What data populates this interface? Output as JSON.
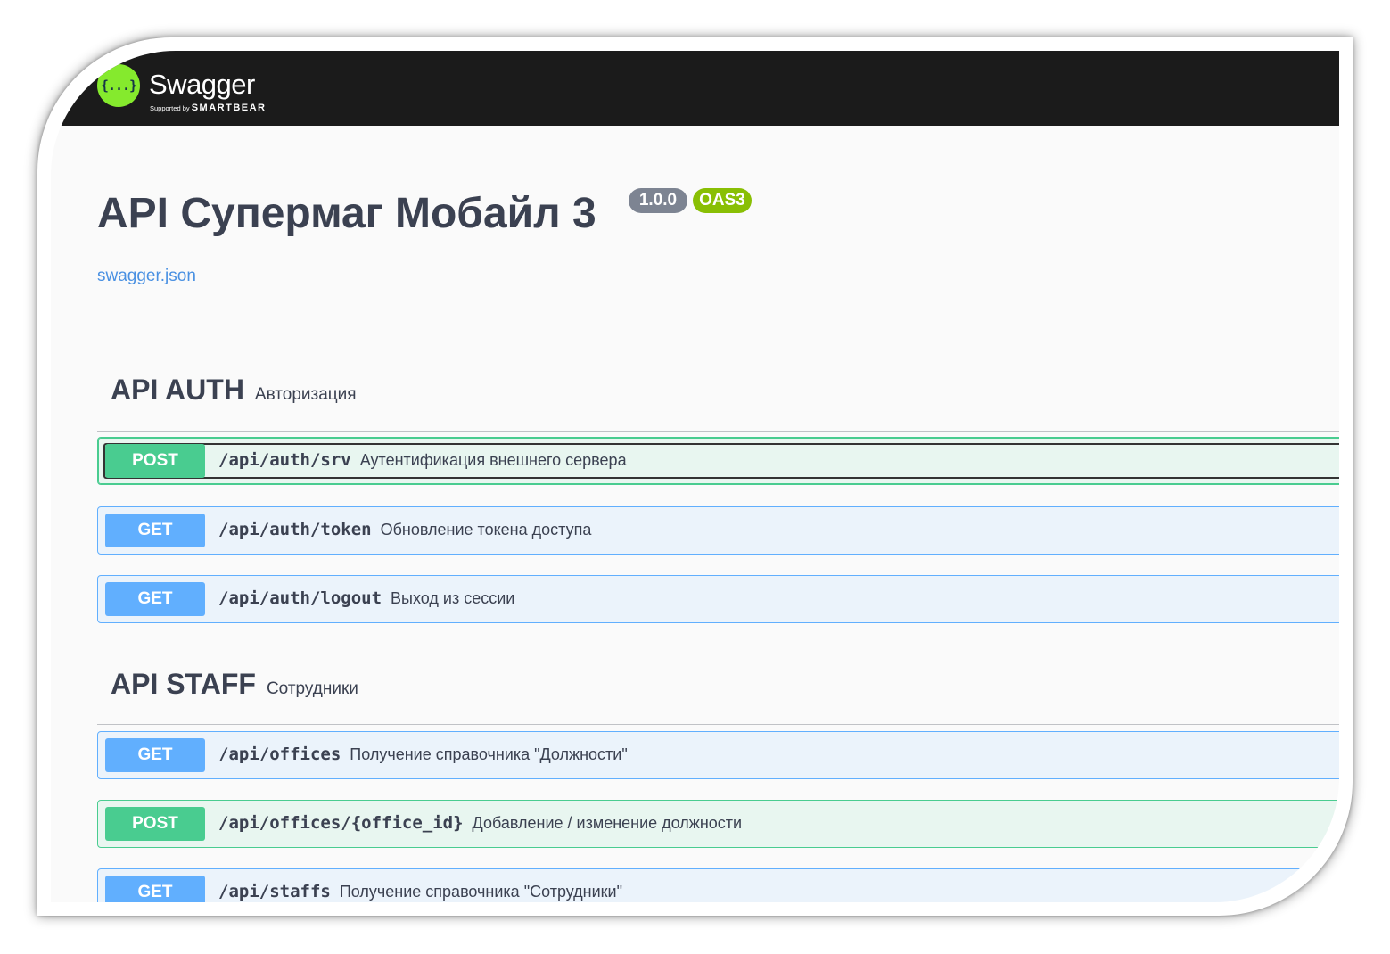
{
  "topbar": {
    "logo_glyph": "{...}",
    "title": "Swagger",
    "supported_by": "Supported by",
    "brand": "SMARTBEAR"
  },
  "info": {
    "title": "API Супермаг Мобайл 3",
    "version": "1.0.0",
    "oas": "OAS3",
    "spec_link": "swagger.json"
  },
  "sections": [
    {
      "name": "API AUTH",
      "description": "Авторизация",
      "operations": [
        {
          "method": "POST",
          "path": "/api/auth/srv",
          "summary": "Аутентификация внешнего сервера"
        },
        {
          "method": "GET",
          "path": "/api/auth/token",
          "summary": "Обновление токена доступа"
        },
        {
          "method": "GET",
          "path": "/api/auth/logout",
          "summary": "Выход из сессии"
        }
      ]
    },
    {
      "name": "API STAFF",
      "description": "Сотрудники",
      "operations": [
        {
          "method": "GET",
          "path": "/api/offices",
          "summary": "Получение справочника \"Должности\""
        },
        {
          "method": "POST",
          "path": "/api/offices/{office_id}",
          "summary": "Добавление / изменение должности"
        },
        {
          "method": "GET",
          "path": "/api/staffs",
          "summary": "Получение справочника \"Сотрудники\""
        }
      ]
    }
  ],
  "colors": {
    "post": "#49cc90",
    "get": "#61affe",
    "logo": "#85ea2d",
    "topbar": "#1b1b1b"
  }
}
